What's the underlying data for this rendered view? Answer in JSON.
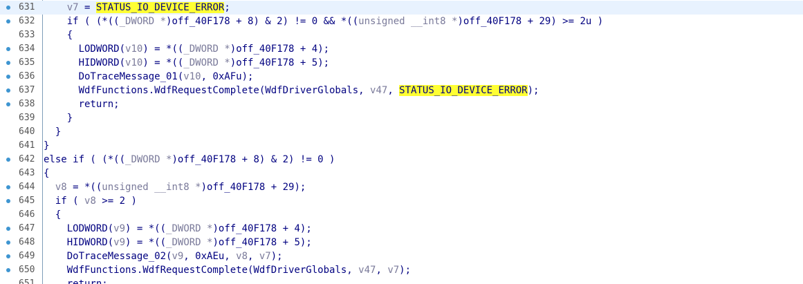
{
  "colors": {
    "background": "#ffffff",
    "code_text": "#000080",
    "muted_identifier": "#7a7a9a",
    "highlight": "#ffff33",
    "breakpoint_dot": "#3e95d1",
    "current_line": "#e8f2fe"
  },
  "icons": {
    "breakpoint": "breakpoint-dot-icon"
  },
  "code_lines": [
    {
      "num": "631",
      "bp": true,
      "current": true,
      "segments": [
        {
          "t": "    "
        },
        {
          "t": "v7",
          "k": "var"
        },
        {
          "t": " = "
        },
        {
          "t": "STATUS_IO_DEVICE_ERROR",
          "k": "hl"
        },
        {
          "t": ";"
        }
      ]
    },
    {
      "num": "632",
      "bp": true,
      "segments": [
        {
          "t": "    if ( (*(("
        },
        {
          "t": "_DWORD *",
          "k": "type"
        },
        {
          "t": ")off_40F178 + 8) & 2) != 0 && *(("
        },
        {
          "t": "unsigned __int8 *",
          "k": "type"
        },
        {
          "t": ")off_40F178 + 29) >= 2u )"
        }
      ]
    },
    {
      "num": "633",
      "bp": false,
      "segments": [
        {
          "t": "    {"
        }
      ]
    },
    {
      "num": "634",
      "bp": true,
      "segments": [
        {
          "t": "      LODWORD("
        },
        {
          "t": "v10",
          "k": "var"
        },
        {
          "t": ") = *(("
        },
        {
          "t": "_DWORD *",
          "k": "type"
        },
        {
          "t": ")off_40F178 + 4);"
        }
      ]
    },
    {
      "num": "635",
      "bp": true,
      "segments": [
        {
          "t": "      HIDWORD("
        },
        {
          "t": "v10",
          "k": "var"
        },
        {
          "t": ") = *(("
        },
        {
          "t": "_DWORD *",
          "k": "type"
        },
        {
          "t": ")off_40F178 + 5);"
        }
      ]
    },
    {
      "num": "636",
      "bp": true,
      "segments": [
        {
          "t": "      DoTraceMessage_01("
        },
        {
          "t": "v10",
          "k": "var"
        },
        {
          "t": ", 0xAFu);"
        }
      ]
    },
    {
      "num": "637",
      "bp": true,
      "segments": [
        {
          "t": "      WdfFunctions.WdfRequestComplete(WdfDriverGlobals, "
        },
        {
          "t": "v47",
          "k": "var"
        },
        {
          "t": ", "
        },
        {
          "t": "STATUS_IO_DEVICE_ERROR",
          "k": "hl"
        },
        {
          "t": ");"
        }
      ]
    },
    {
      "num": "638",
      "bp": true,
      "segments": [
        {
          "t": "      return;"
        }
      ]
    },
    {
      "num": "639",
      "bp": false,
      "segments": [
        {
          "t": "    }"
        }
      ]
    },
    {
      "num": "640",
      "bp": false,
      "segments": [
        {
          "t": "  }"
        }
      ]
    },
    {
      "num": "641",
      "bp": false,
      "segments": [
        {
          "t": "}"
        }
      ]
    },
    {
      "num": "642",
      "bp": true,
      "segments": [
        {
          "t": "else if ( (*(("
        },
        {
          "t": "_DWORD *",
          "k": "type"
        },
        {
          "t": ")off_40F178 + 8) & 2) != 0 )"
        }
      ]
    },
    {
      "num": "643",
      "bp": false,
      "segments": [
        {
          "t": "{"
        }
      ]
    },
    {
      "num": "644",
      "bp": true,
      "segments": [
        {
          "t": "  "
        },
        {
          "t": "v8",
          "k": "var"
        },
        {
          "t": " = *(("
        },
        {
          "t": "unsigned __int8 *",
          "k": "type"
        },
        {
          "t": ")off_40F178 + 29);"
        }
      ]
    },
    {
      "num": "645",
      "bp": true,
      "segments": [
        {
          "t": "  if ( "
        },
        {
          "t": "v8",
          "k": "var"
        },
        {
          "t": " >= 2 )"
        }
      ]
    },
    {
      "num": "646",
      "bp": false,
      "segments": [
        {
          "t": "  {"
        }
      ]
    },
    {
      "num": "647",
      "bp": true,
      "segments": [
        {
          "t": "    LODWORD("
        },
        {
          "t": "v9",
          "k": "var"
        },
        {
          "t": ") = *(("
        },
        {
          "t": "_DWORD *",
          "k": "type"
        },
        {
          "t": ")off_40F178 + 4);"
        }
      ]
    },
    {
      "num": "648",
      "bp": true,
      "segments": [
        {
          "t": "    HIDWORD("
        },
        {
          "t": "v9",
          "k": "var"
        },
        {
          "t": ") = *(("
        },
        {
          "t": "_DWORD *",
          "k": "type"
        },
        {
          "t": ")off_40F178 + 5);"
        }
      ]
    },
    {
      "num": "649",
      "bp": true,
      "segments": [
        {
          "t": "    DoTraceMessage_02("
        },
        {
          "t": "v9",
          "k": "var"
        },
        {
          "t": ", 0xAEu, "
        },
        {
          "t": "v8",
          "k": "var"
        },
        {
          "t": ", "
        },
        {
          "t": "v7",
          "k": "var"
        },
        {
          "t": ");"
        }
      ]
    },
    {
      "num": "650",
      "bp": true,
      "segments": [
        {
          "t": "    WdfFunctions.WdfRequestComplete(WdfDriverGlobals, "
        },
        {
          "t": "v47",
          "k": "var"
        },
        {
          "t": ", "
        },
        {
          "t": "v7",
          "k": "var"
        },
        {
          "t": ");"
        }
      ]
    },
    {
      "num": "651",
      "bp": false,
      "segments": [
        {
          "t": "    return;"
        }
      ]
    }
  ]
}
